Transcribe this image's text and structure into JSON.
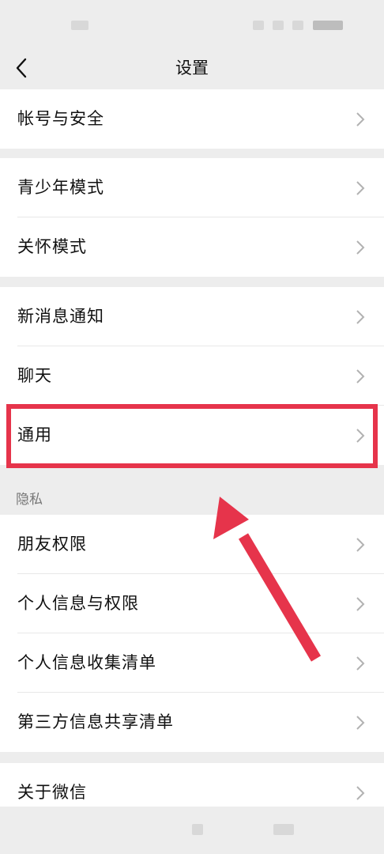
{
  "header": {
    "title": "设置"
  },
  "groups": [
    {
      "items": [
        {
          "label": "帐号与安全"
        }
      ]
    },
    {
      "items": [
        {
          "label": "青少年模式"
        },
        {
          "label": "关怀模式"
        }
      ]
    },
    {
      "items": [
        {
          "label": "新消息通知"
        },
        {
          "label": "聊天"
        },
        {
          "label": "通用"
        }
      ]
    },
    {
      "section_label": "隐私",
      "items": [
        {
          "label": "朋友权限"
        },
        {
          "label": "个人信息与权限"
        },
        {
          "label": "个人信息收集清单"
        },
        {
          "label": "第三方信息共享清单"
        }
      ]
    },
    {
      "items": [
        {
          "label": "关于微信"
        }
      ]
    }
  ],
  "annotation": {
    "highlight_color": "#e6344b",
    "highlighted_item": "通用"
  },
  "colors": {
    "background": "#ededed",
    "card": "#ffffff",
    "text": "#111111",
    "chevron": "#b2b2b2"
  },
  "icons": {
    "back": "chevron-left-icon",
    "row": "chevron-right-icon"
  }
}
